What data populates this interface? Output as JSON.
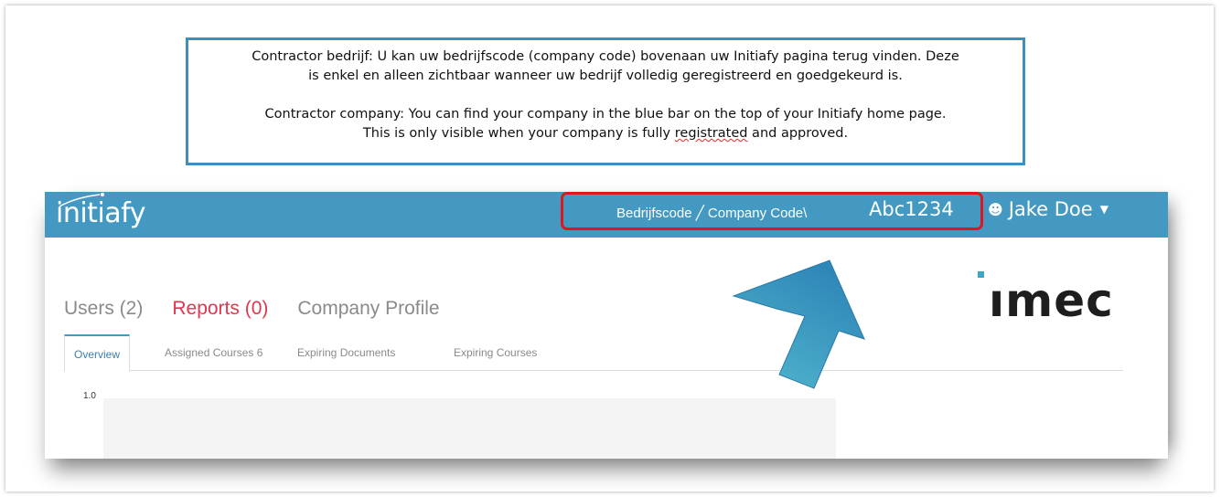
{
  "note": {
    "dutch_line1": "Contractor bedrijf: U kan uw bedrijfscode (company code) bovenaan uw Initiafy pagina terug vinden. Deze",
    "dutch_line2": "is enkel en alleen zichtbaar wanneer uw bedrijf volledig geregistreerd en goedgekeurd is.",
    "english_line1": "Contractor company: You can find your company in the blue bar on the top of your Initiafy home page.",
    "english_line2_a": "This is only visible when your company is fully ",
    "english_line2_underlined": "registrated",
    "english_line2_b": " and approved."
  },
  "topbar": {
    "logo": "initiafy",
    "company_code_label": "Bedrijfscode ╱ Company Code\\",
    "company_code_value": "Abc1234",
    "user_name": "Jake Doe",
    "user_icon": "user-icon",
    "caret_icon": "caret-down-icon"
  },
  "brand": {
    "logo_text": "ımec"
  },
  "tabs": {
    "main": [
      {
        "label": "Users (2)",
        "active": false
      },
      {
        "label": "Reports (0)",
        "active": true
      },
      {
        "label": "Company Profile",
        "active": false
      }
    ],
    "sub": [
      {
        "label": "Overview",
        "active": true
      },
      {
        "label": "Assigned Courses 6",
        "active": false
      },
      {
        "label": "Expiring Documents",
        "active": false
      },
      {
        "label": "Expiring Courses",
        "active": false
      }
    ]
  },
  "chart": {
    "y_tick_top": "1.0"
  },
  "colors": {
    "topbar": "#4399c2",
    "highlight_box": "#e0161e",
    "note_border": "#3d8fbd",
    "active_main_tab": "#e0374f",
    "arrow": "#3a9fc4"
  }
}
